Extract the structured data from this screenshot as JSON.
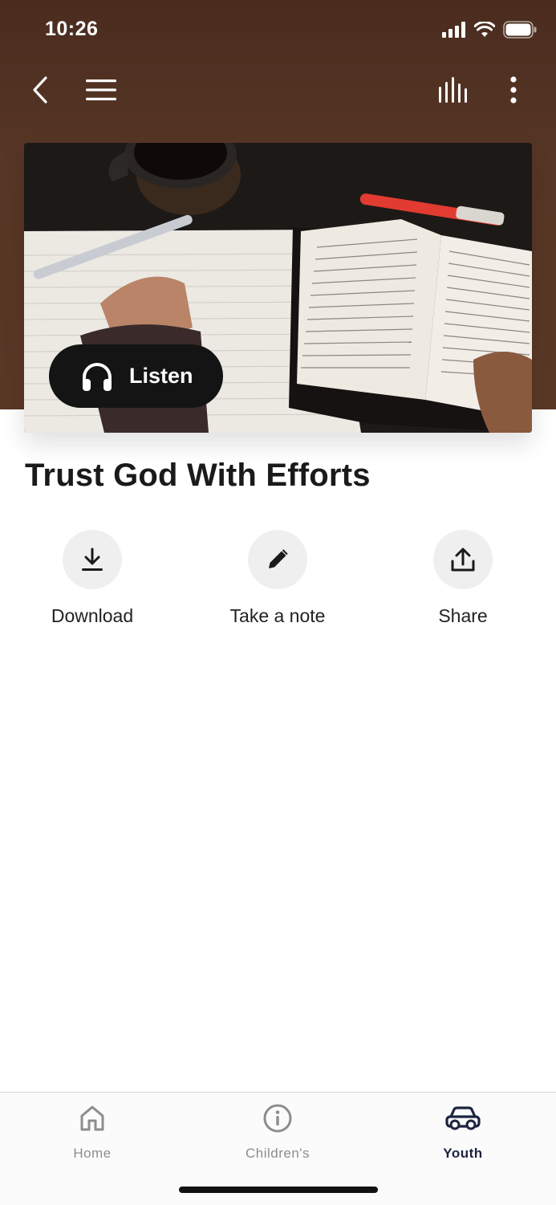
{
  "status_bar": {
    "time": "10:26"
  },
  "nav": {
    "icons": [
      "back-icon",
      "menu-icon",
      "audio-bars-icon",
      "more-vertical-icon"
    ]
  },
  "hero": {
    "listen_label": "Listen",
    "listen_icon": "headphones-icon"
  },
  "content": {
    "title": "Trust God With Efforts",
    "actions": [
      {
        "label": "Download",
        "icon": "download-icon"
      },
      {
        "label": "Take a note",
        "icon": "pencil-icon"
      },
      {
        "label": "Share",
        "icon": "share-icon"
      }
    ]
  },
  "tab_bar": {
    "tabs": [
      {
        "label": "Home",
        "icon": "home-icon",
        "active": false
      },
      {
        "label": "Children's",
        "icon": "info-icon",
        "active": false
      },
      {
        "label": "Youth",
        "icon": "car-icon",
        "active": true
      }
    ]
  },
  "colors": {
    "header_brown": "#573625",
    "listen_bg": "#141414",
    "active_tab": "#1d2440",
    "inactive_tab": "#8d8d8d",
    "action_circle": "#efeff0"
  }
}
